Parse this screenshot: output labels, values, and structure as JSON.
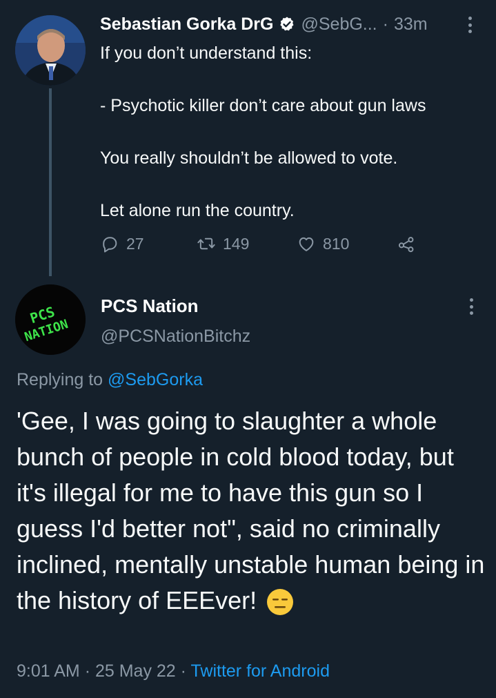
{
  "parent_tweet": {
    "display_name": "Sebastian Gorka DrG",
    "handle": "@SebG...",
    "separator": "·",
    "time_ago": "33m",
    "text": "If you don’t understand this:\n\n- Psychotic killer don’t care about gun laws\n\nYou really shouldn’t be allowed to vote.\n\nLet alone run the country.",
    "reply_count": "27",
    "retweet_count": "149",
    "like_count": "810"
  },
  "reply_tweet": {
    "display_name": "PCS Nation",
    "handle": "@PCSNationBitchz",
    "avatar_text_line1": "PCS",
    "avatar_text_line2": "NATION",
    "replying_prefix": "Replying to ",
    "replying_to": "@SebGorka",
    "text": "'Gee, I was going to slaughter a whole bunch of people in cold blood today, but it's illegal for me to have this gun so I guess I'd better not\", said no criminally inclined, mentally unstable human being in the history of EEEver!",
    "time": "9:01 AM",
    "separator1": "·",
    "date": "25 May 22",
    "separator2": "·",
    "source": "Twitter for Android"
  },
  "colors": {
    "background": "#15202b",
    "secondary_text": "#8b98a5",
    "link": "#1d9bf0",
    "avatar_text": "#3ee44a"
  },
  "icons": [
    "verified-icon",
    "more-icon",
    "reply-icon",
    "retweet-icon",
    "like-icon",
    "share-icon",
    "expressionless-emoji"
  ]
}
